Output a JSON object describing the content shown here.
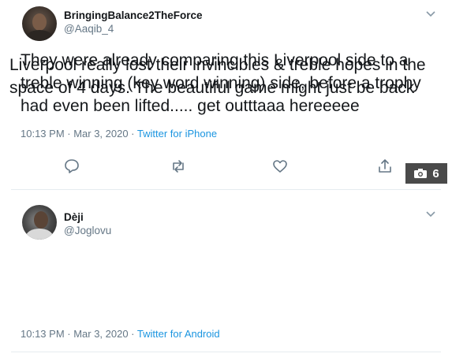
{
  "tweets": [
    {
      "display_name": "BringingBalance2TheForce",
      "handle": "@Aaqib_4",
      "text": "They were already comparing this Liverpool side to a treble winning (key word winning) side, before a trophy had even been lifted..... get outttaaa hereeeee",
      "timestamp": "10:13 PM · Mar 3, 2020 · ",
      "source": "Twitter for iPhone",
      "icons": [
        "reply-icon",
        "retweet-icon",
        "like-icon",
        "share-icon"
      ]
    },
    {
      "display_name": "Dèji",
      "handle": "@Joglovu",
      "text": "Liverpool really lost their invincibles & treble hopes in the space of 4 days. The beautiful game might just be back",
      "timestamp": "10:13 PM · Mar 3, 2020 · ",
      "source": "Twitter for Android"
    }
  ],
  "photo_badge": {
    "count": "6",
    "icon": "camera-icon"
  },
  "colors": {
    "link": "#1b95e0",
    "muted": "#657786",
    "text": "#14171a",
    "badge_bg": "#4a4a4a"
  }
}
